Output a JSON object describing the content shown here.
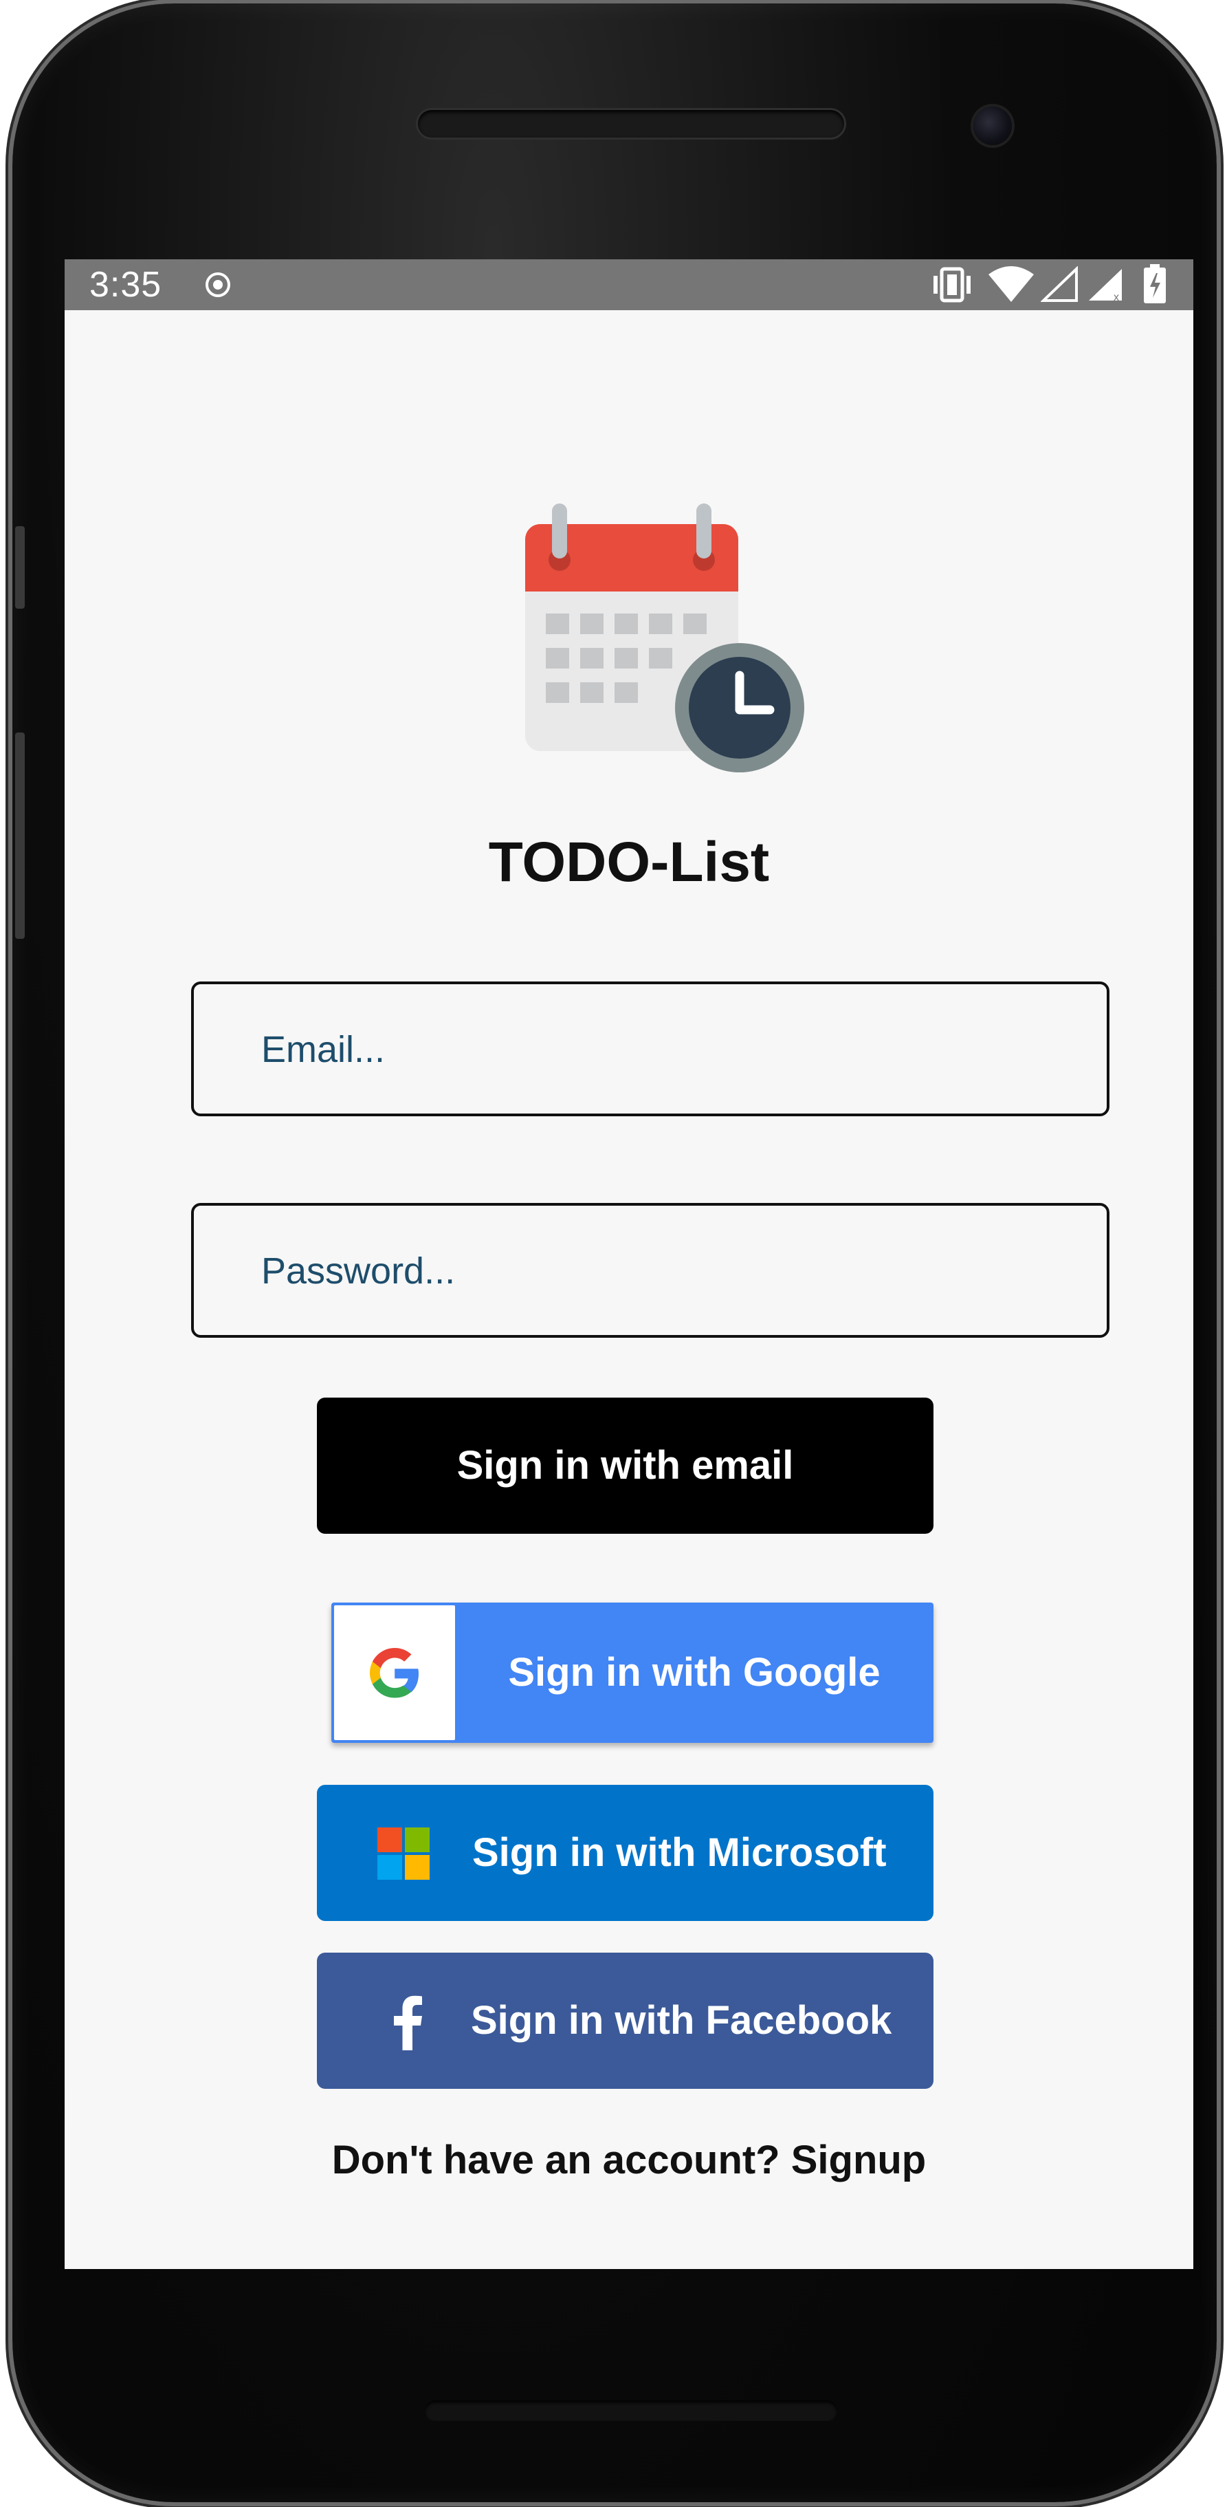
{
  "status_bar": {
    "time": "3:35"
  },
  "app": {
    "title": "TODO-List"
  },
  "login_form": {
    "email_placeholder": "Email...",
    "password_placeholder": "Password...",
    "email_button_label": "Sign in with email",
    "google_button_label": "Sign in with Google",
    "microsoft_button_label": "Sign in with Microsoft",
    "facebook_button_label": "Sign in with Facebook",
    "signup_prompt": "Don't have an account? Signup"
  },
  "icons": {
    "status_left": [
      "recording-dot-icon"
    ],
    "status_right": [
      "vibrate-icon",
      "wifi-icon",
      "signal-empty-icon",
      "signal-icon",
      "battery-icon"
    ],
    "logo": "calendar-clock-icon"
  },
  "colors": {
    "background": "#f7f7f7",
    "status_bar": "#767676",
    "email_button": "#000000",
    "google_button": "#4285f4",
    "microsoft_button": "#0174c9",
    "facebook_button": "#3c5a99",
    "input_text": "#1e4d6b"
  }
}
